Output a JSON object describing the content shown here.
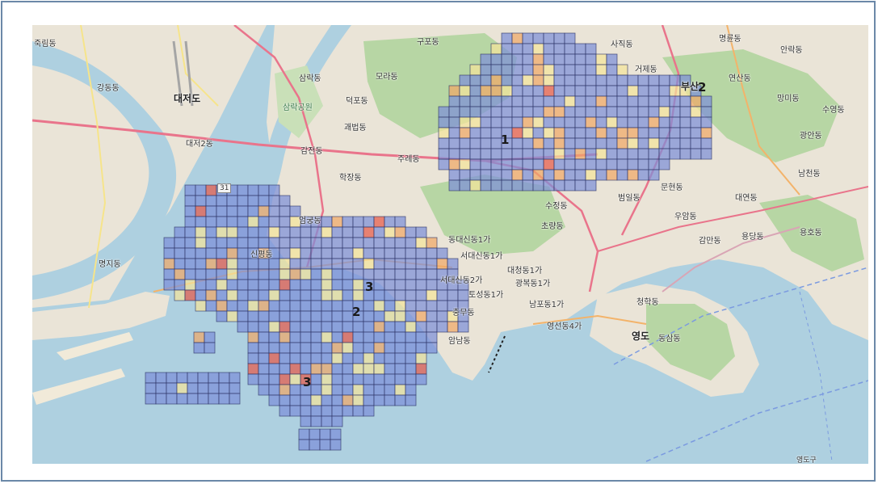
{
  "map": {
    "colors": {
      "water": "#aed0e0",
      "land": "#eae4d7",
      "park": "#b7d6a4",
      "cell_blue": "#7d8fd8",
      "cell_yellow": "#f4e39a",
      "cell_orange": "#f0a766",
      "cell_red": "#e65a4a",
      "grid_line": "#2b3163"
    },
    "place_labels": [
      {
        "id": "jukrimdong",
        "text": "죽림동"
      },
      {
        "id": "gangdongdong",
        "text": "강동동"
      },
      {
        "id": "daejeodo",
        "text": "대저도"
      },
      {
        "id": "daejeo2dong",
        "text": "대저2동"
      },
      {
        "id": "gupodong",
        "text": "구포동"
      },
      {
        "id": "samrakdong",
        "text": "삼락동"
      },
      {
        "id": "moradong",
        "text": "모라동"
      },
      {
        "id": "samrakpark",
        "text": "삼락공원"
      },
      {
        "id": "deokpodong",
        "text": "덕포동"
      },
      {
        "id": "gwaebeopdong",
        "text": "괘법동"
      },
      {
        "id": "gamjeondong",
        "text": "감전동"
      },
      {
        "id": "jurye",
        "text": "주례동"
      },
      {
        "id": "haksangdong",
        "text": "학장동"
      },
      {
        "id": "sijikdong",
        "text": "사직동"
      },
      {
        "id": "allakdong",
        "text": "안락동"
      },
      {
        "id": "myeongnyun",
        "text": "명륜동"
      },
      {
        "id": "geojedong",
        "text": "거제동"
      },
      {
        "id": "yeonsandong",
        "text": "연산동"
      },
      {
        "id": "mangmidong",
        "text": "망미동"
      },
      {
        "id": "suyeongdong",
        "text": "수영동"
      },
      {
        "id": "gwanganidong",
        "text": "광안동"
      },
      {
        "id": "namcheondong",
        "text": "남천동"
      },
      {
        "id": "daeyeondong",
        "text": "대연동"
      },
      {
        "id": "yonghodong",
        "text": "용호동"
      },
      {
        "id": "munhyeondong",
        "text": "문현동"
      },
      {
        "id": "beomildong",
        "text": "범일동"
      },
      {
        "id": "sujeongdong",
        "text": "수정동"
      },
      {
        "id": "choryangdong",
        "text": "초량동"
      },
      {
        "id": "uamdong",
        "text": "우암동"
      },
      {
        "id": "gamman",
        "text": "감만동"
      },
      {
        "id": "yongdang",
        "text": "용당동"
      },
      {
        "id": "eomgungdong",
        "text": "엄궁동"
      },
      {
        "id": "dongdaesin1",
        "text": "동대신동1가"
      },
      {
        "id": "seodaesin1",
        "text": "서대신동1가"
      },
      {
        "id": "daecheong1",
        "text": "대청동1가"
      },
      {
        "id": "gwangbok1",
        "text": "광복동1가"
      },
      {
        "id": "seodaesin2",
        "text": "서대신동2가"
      },
      {
        "id": "toseong1",
        "text": "토성동1가"
      },
      {
        "id": "nampo",
        "text": "남포동1가"
      },
      {
        "id": "chungmu",
        "text": "충무동"
      },
      {
        "id": "amnam",
        "text": "암남동"
      },
      {
        "id": "yeongseon4",
        "text": "영선동4가"
      },
      {
        "id": "cheonghak",
        "text": "청학동"
      },
      {
        "id": "yeongdo",
        "text": "영도"
      },
      {
        "id": "dongsam",
        "text": "동삼동"
      },
      {
        "id": "myeongji",
        "text": "명지동"
      },
      {
        "id": "sinpyeong",
        "text": "신평동"
      },
      {
        "id": "road31",
        "text": "31"
      },
      {
        "id": "busan",
        "text": "부산"
      },
      {
        "id": "yeongdogu",
        "text": "영도구"
      }
    ],
    "cluster_markers": [
      {
        "id": "marker-1",
        "text": "1"
      },
      {
        "id": "marker-2-top",
        "text": "2"
      },
      {
        "id": "marker-2-south",
        "text": "2"
      },
      {
        "id": "marker-3-upper",
        "text": "3"
      },
      {
        "id": "marker-3-lower",
        "text": "3"
      }
    ]
  }
}
